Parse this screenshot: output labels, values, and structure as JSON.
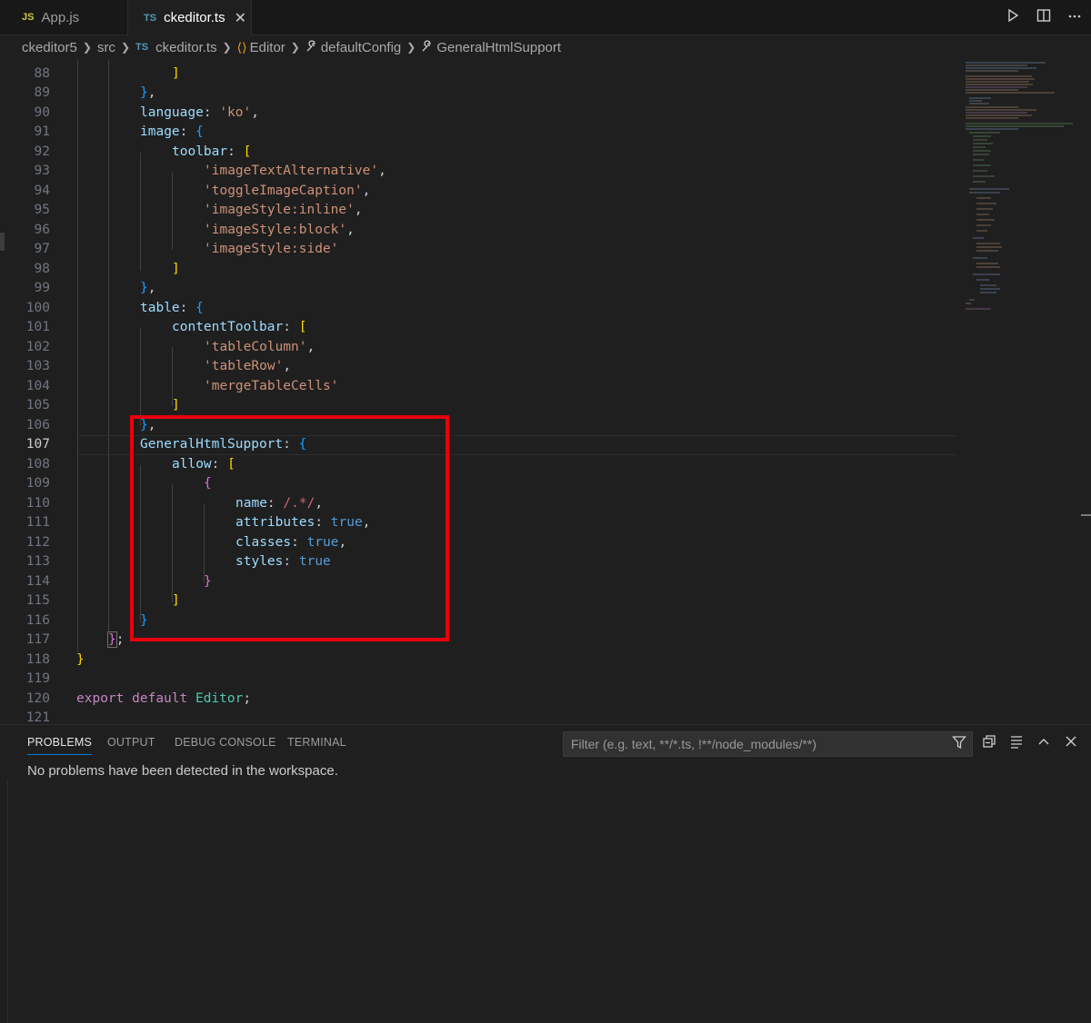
{
  "tabs": [
    {
      "lang": "JS",
      "label": "App.js"
    },
    {
      "lang": "TS",
      "label": "ckeditor.ts",
      "close": "✕"
    }
  ],
  "breadcrumb": {
    "items": [
      "ckeditor5",
      "src",
      "ckeditor.ts",
      "Editor",
      "defaultConfig",
      "GeneralHtmlSupport"
    ],
    "ts_badge": "TS"
  },
  "editor": {
    "current_line": 107,
    "lines": [
      {
        "n": "88"
      },
      {
        "n": "89"
      },
      {
        "n": "90"
      },
      {
        "n": "91"
      },
      {
        "n": "92"
      },
      {
        "n": "93"
      },
      {
        "n": "94"
      },
      {
        "n": "95"
      },
      {
        "n": "96"
      },
      {
        "n": "97"
      },
      {
        "n": "98"
      },
      {
        "n": "99"
      },
      {
        "n": "100"
      },
      {
        "n": "101"
      },
      {
        "n": "102"
      },
      {
        "n": "103"
      },
      {
        "n": "104"
      },
      {
        "n": "105"
      },
      {
        "n": "106"
      },
      {
        "n": "107"
      },
      {
        "n": "108"
      },
      {
        "n": "109"
      },
      {
        "n": "110"
      },
      {
        "n": "111"
      },
      {
        "n": "112"
      },
      {
        "n": "113"
      },
      {
        "n": "114"
      },
      {
        "n": "115"
      },
      {
        "n": "116"
      },
      {
        "n": "117"
      },
      {
        "n": "118"
      },
      {
        "n": "119"
      },
      {
        "n": "120"
      },
      {
        "n": "121"
      }
    ],
    "tokens": {
      "language": "language",
      "ko": "'ko'",
      "image": "image",
      "toolbar": "toolbar",
      "imgTextAlt": "'imageTextAlternative'",
      "toggleCaption": "'toggleImageCaption'",
      "styleInline": "'imageStyle:inline'",
      "styleBlock": "'imageStyle:block'",
      "styleSide": "'imageStyle:side'",
      "table": "table",
      "contentToolbar": "contentToolbar",
      "tableColumn": "'tableColumn'",
      "tableRow": "'tableRow'",
      "mergeCells": "'mergeTableCells'",
      "ghs": "GeneralHtmlSupport",
      "allow": "allow",
      "name": "name",
      "regex": "/.*/",
      "attributes": "attributes",
      "classes": "classes",
      "styles": "styles",
      "true": "true",
      "export": "export",
      "default": "default",
      "Editor": "Editor"
    }
  },
  "panel": {
    "tabs": [
      "PROBLEMS",
      "OUTPUT",
      "DEBUG CONSOLE",
      "TERMINAL"
    ],
    "filter_placeholder": "Filter (e.g. text, **/*.ts, !**/node_modules/**)",
    "message": "No problems have been detected in the workspace."
  }
}
